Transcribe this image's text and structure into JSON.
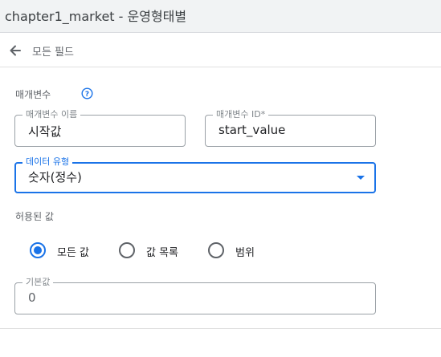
{
  "window": {
    "title": "chapter1_market - 운영형태별"
  },
  "nav": {
    "back_label": "모든 필드"
  },
  "params": {
    "section_label": "매개변수",
    "name_field": {
      "label": "매개변수 이름",
      "value": "시작값"
    },
    "id_field": {
      "label": "매개변수 ID*",
      "value": "start_value"
    },
    "data_type": {
      "label": "데이터 유형",
      "value": "숫자(정수)"
    }
  },
  "allowed_values": {
    "label": "허용된 값",
    "options": [
      "모든 값",
      "값 목록",
      "범위"
    ],
    "selected": "모든 값"
  },
  "default_field": {
    "label": "기본값",
    "value": "0"
  },
  "colors": {
    "accent": "#1a73e8",
    "border": "#9aa0a6",
    "muted_text": "#5f6368"
  }
}
